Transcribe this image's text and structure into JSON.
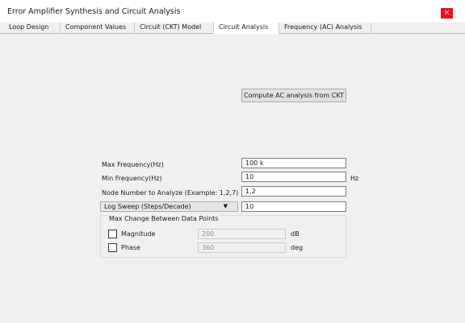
{
  "window": {
    "title": "Error Amplifier Synthesis and Circuit Analysis",
    "close_label": "×"
  },
  "tabs": [
    {
      "label": "Loop Design"
    },
    {
      "label": "Component Values"
    },
    {
      "label": "Circuit (CKT) Model"
    },
    {
      "label": "Circuit Analysis",
      "active": true
    },
    {
      "label": "Frequency (AC) Analysis"
    }
  ],
  "compute_button": "Compute AC analysis from CKT",
  "fields": {
    "max_freq": {
      "label": "Max Frequency(Hz)",
      "value": "100 k"
    },
    "min_freq": {
      "label": "Min Frequency(Hz)",
      "value": "10",
      "unit": "Hz"
    },
    "node": {
      "label": "Node Number to Analyze (Example: 1,2,7)",
      "value": "1,2"
    },
    "sweep": {
      "selected": "Log Sweep (Steps/Decade)",
      "value": "10"
    }
  },
  "max_change": {
    "title": "Max Change Between Data Points",
    "magnitude": {
      "label": "Magnitude",
      "value": "200",
      "unit": "dB",
      "checked": false
    },
    "phase": {
      "label": "Phase",
      "value": "360",
      "unit": "deg",
      "checked": false
    }
  }
}
